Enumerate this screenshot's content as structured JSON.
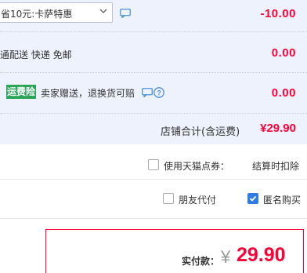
{
  "promo": {
    "selected": "省10元:卡萨特惠",
    "amount": "-10.00"
  },
  "shipping": {
    "text": "通配送 快递 免邮",
    "amount": "0.00"
  },
  "insurance": {
    "badge": "运费险",
    "text": "卖家赠送，退换货可赔",
    "amount": "0.00"
  },
  "store_total": {
    "label": "店铺合计(含运费)",
    "value": "¥29.90"
  },
  "points": {
    "label": "使用天猫点券：",
    "status": "结算时扣除"
  },
  "options": {
    "friend_pay_label": "朋友代付",
    "anonymous_label": "匿名购买"
  },
  "payment": {
    "label": "实付款：",
    "currency": "¥",
    "value": "29.90"
  },
  "colors": {
    "accent_red": "#ff0036",
    "panel_bg": "#eef2fd",
    "badge_green": "#2aa558",
    "checkbox_blue": "#2f7de1",
    "icon_blue": "#4a90d9"
  }
}
